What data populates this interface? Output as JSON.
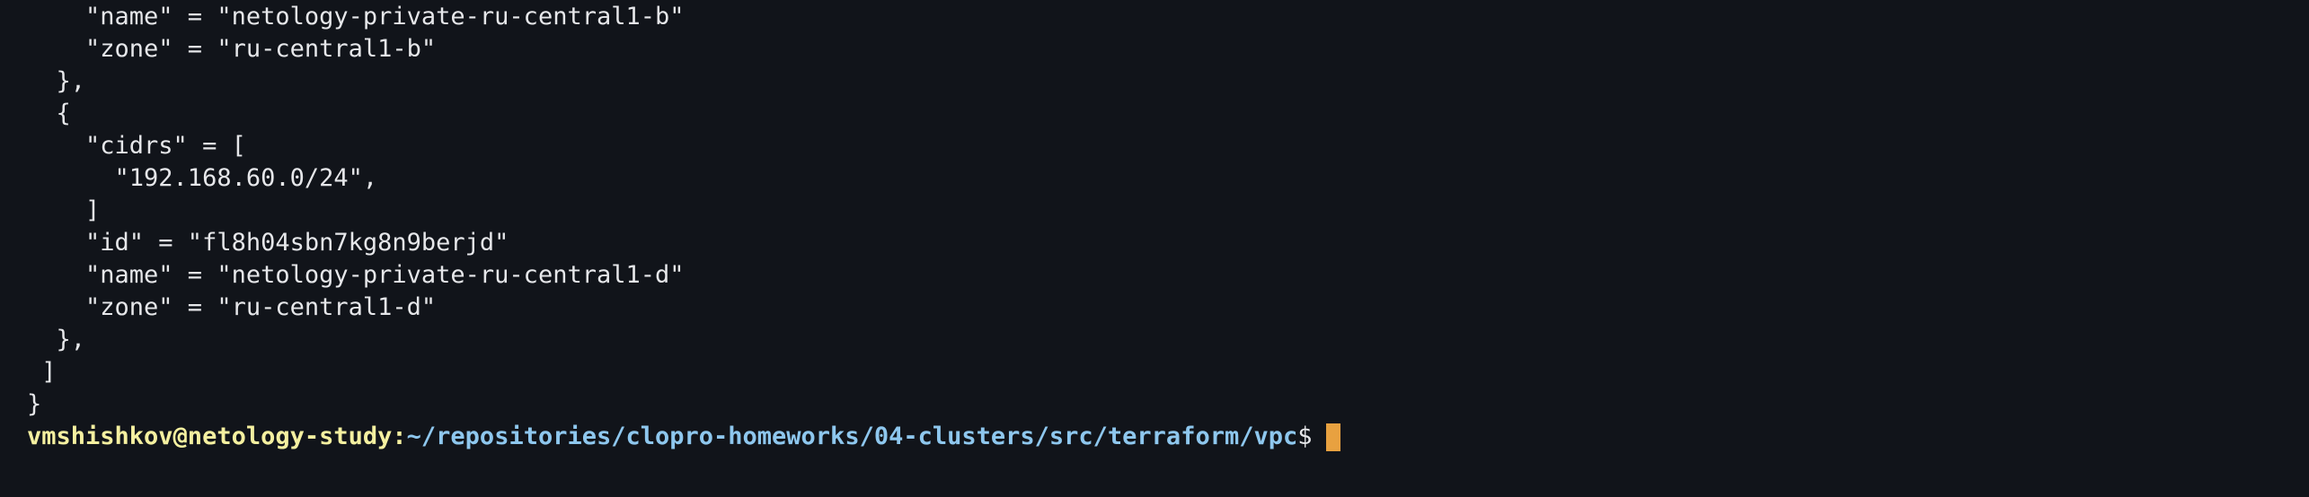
{
  "terminal": {
    "output_lines": [
      "    \"name\" = \"netology-private-ru-central1-b\"",
      "    \"zone\" = \"ru-central1-b\"",
      "  },",
      "  {",
      "    \"cidrs\" = [",
      "      \"192.168.60.0/24\",",
      "    ]",
      "    \"id\" = \"fl8h04sbn7kg8n9berjd\"",
      "    \"name\" = \"netology-private-ru-central1-d\"",
      "    \"zone\" = \"ru-central1-d\"",
      "  },",
      " ]",
      "}"
    ],
    "prompt": {
      "user_host": "vmshishkov@netology-study",
      "colon": ":",
      "path": "~/repositories/clopro-homeworks/04-clusters/src/terraform/vpc",
      "dollar": "$"
    },
    "colors": {
      "background": "#11141a",
      "text": "#e6e7ea",
      "user_host": "#f5f0a0",
      "path": "#8ec7ee",
      "cursor": "#e8a140"
    }
  }
}
